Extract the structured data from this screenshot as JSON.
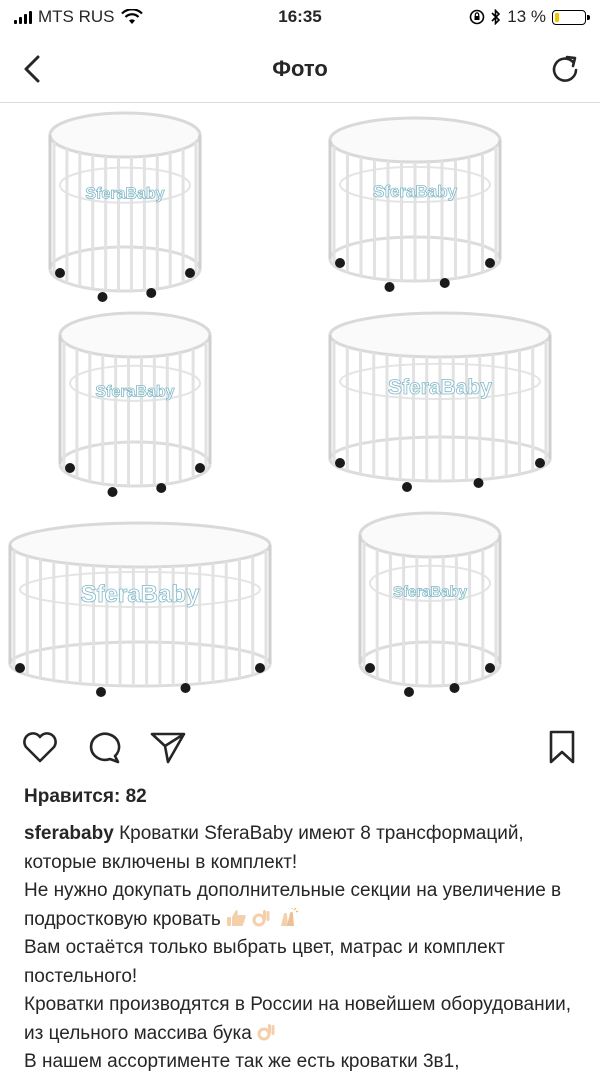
{
  "status_bar": {
    "carrier": "MTS RUS",
    "time": "16:35",
    "battery": "13 %",
    "battery_level": 0.13,
    "battery_color": "#f5c400"
  },
  "navbar": {
    "title": "Фото",
    "back_icon": "chevron-left-icon",
    "refresh_icon": "refresh-icon"
  },
  "photo": {
    "watermark": "SferaBaby"
  },
  "actions": {
    "like_icon": "heart-icon",
    "comment_icon": "comment-icon",
    "share_icon": "paper-plane-icon",
    "save_icon": "bookmark-icon"
  },
  "likes": "Нравится: 82",
  "caption": {
    "username": "sferababy",
    "lines": [
      "Кроватки SferaBaby имеют 8 трансформаций, которые включены в комплект!",
      "Не нужно докупать дополнительные секции на увеличение в подростковую кровать",
      "Вам остаётся только выбрать цвет, матрас и комплект постельного!",
      "Кроватки производятся в России на новейшем оборудовании, из цельного массива бука",
      "В нашем ассортименте так же есть кроватки 3в1,"
    ]
  }
}
